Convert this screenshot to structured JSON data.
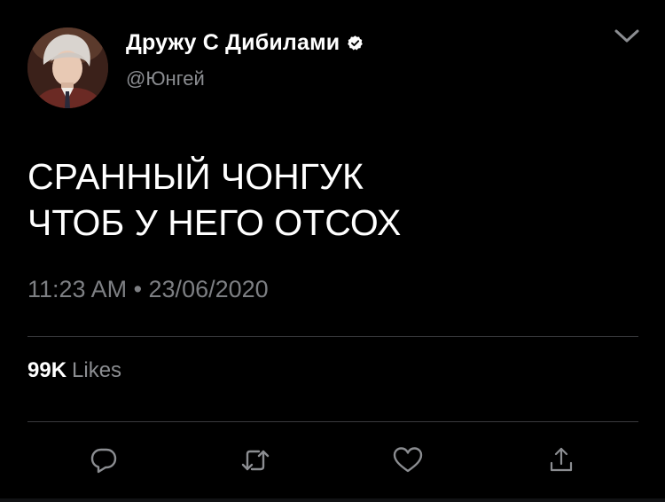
{
  "tweet": {
    "display_name": "Дружу С Дибилами",
    "handle": "@Юнгей",
    "text_lines": [
      "СРАННЫЙ ЧОНГУК",
      "ЧТОБ У НЕГО ОТСОХ"
    ],
    "timestamp": "11:23 AM • 23/06/2020",
    "likes_count": "99K",
    "likes_label": "Likes",
    "verified": true
  },
  "actions": [
    {
      "icon": "reply-icon"
    },
    {
      "icon": "retweet-icon"
    },
    {
      "icon": "like-icon"
    },
    {
      "icon": "share-icon"
    }
  ],
  "colors": {
    "background": "#000000",
    "primary_text": "#ffffff",
    "secondary_text": "#8b8d91",
    "divider": "#3a3b3e",
    "icon": "#8b8d91"
  }
}
